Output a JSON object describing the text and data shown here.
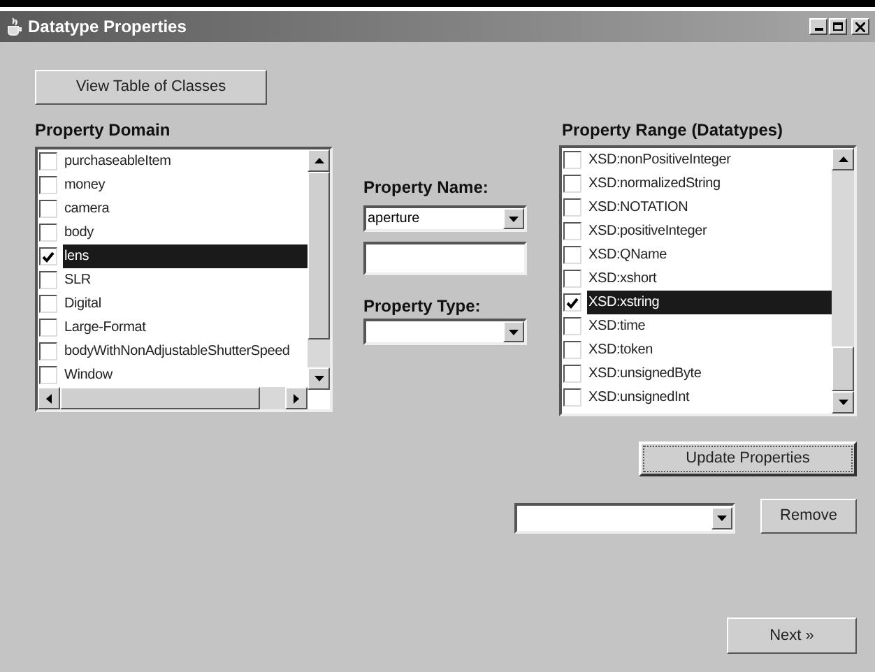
{
  "window": {
    "title": "Datatype Properties"
  },
  "view_table_button": "View Table of Classes",
  "property_domain": {
    "label": "Property Domain",
    "items": [
      {
        "label": "purchaseableItem",
        "checked": false,
        "selected": false
      },
      {
        "label": "money",
        "checked": false,
        "selected": false
      },
      {
        "label": "camera",
        "checked": false,
        "selected": false
      },
      {
        "label": "body",
        "checked": false,
        "selected": false
      },
      {
        "label": "lens",
        "checked": true,
        "selected": true
      },
      {
        "label": "SLR",
        "checked": false,
        "selected": false
      },
      {
        "label": "Digital",
        "checked": false,
        "selected": false
      },
      {
        "label": "Large-Format",
        "checked": false,
        "selected": false
      },
      {
        "label": "bodyWithNonAdjustableShutterSpeed",
        "checked": false,
        "selected": false
      },
      {
        "label": "Window",
        "checked": false,
        "selected": false
      }
    ]
  },
  "property_name": {
    "label": "Property Name:",
    "value": "aperture"
  },
  "property_type": {
    "label": "Property Type:"
  },
  "property_range": {
    "label": "Property Range (Datatypes)",
    "items": [
      {
        "label": "XSD:nonPositiveInteger",
        "checked": false,
        "selected": false
      },
      {
        "label": "XSD:normalizedString",
        "checked": false,
        "selected": false
      },
      {
        "label": "XSD:NOTATION",
        "checked": false,
        "selected": false
      },
      {
        "label": "XSD:positiveInteger",
        "checked": false,
        "selected": false
      },
      {
        "label": "XSD:QName",
        "checked": false,
        "selected": false
      },
      {
        "label": "XSD:xshort",
        "checked": false,
        "selected": false
      },
      {
        "label": "XSD:xstring",
        "checked": true,
        "selected": true
      },
      {
        "label": "XSD:time",
        "checked": false,
        "selected": false
      },
      {
        "label": "XSD:token",
        "checked": false,
        "selected": false
      },
      {
        "label": "XSD:unsignedByte",
        "checked": false,
        "selected": false
      },
      {
        "label": "XSD:unsignedInt",
        "checked": false,
        "selected": false
      }
    ]
  },
  "update_button": "Update Properties",
  "remove_button": "Remove",
  "next_button": "Next »"
}
